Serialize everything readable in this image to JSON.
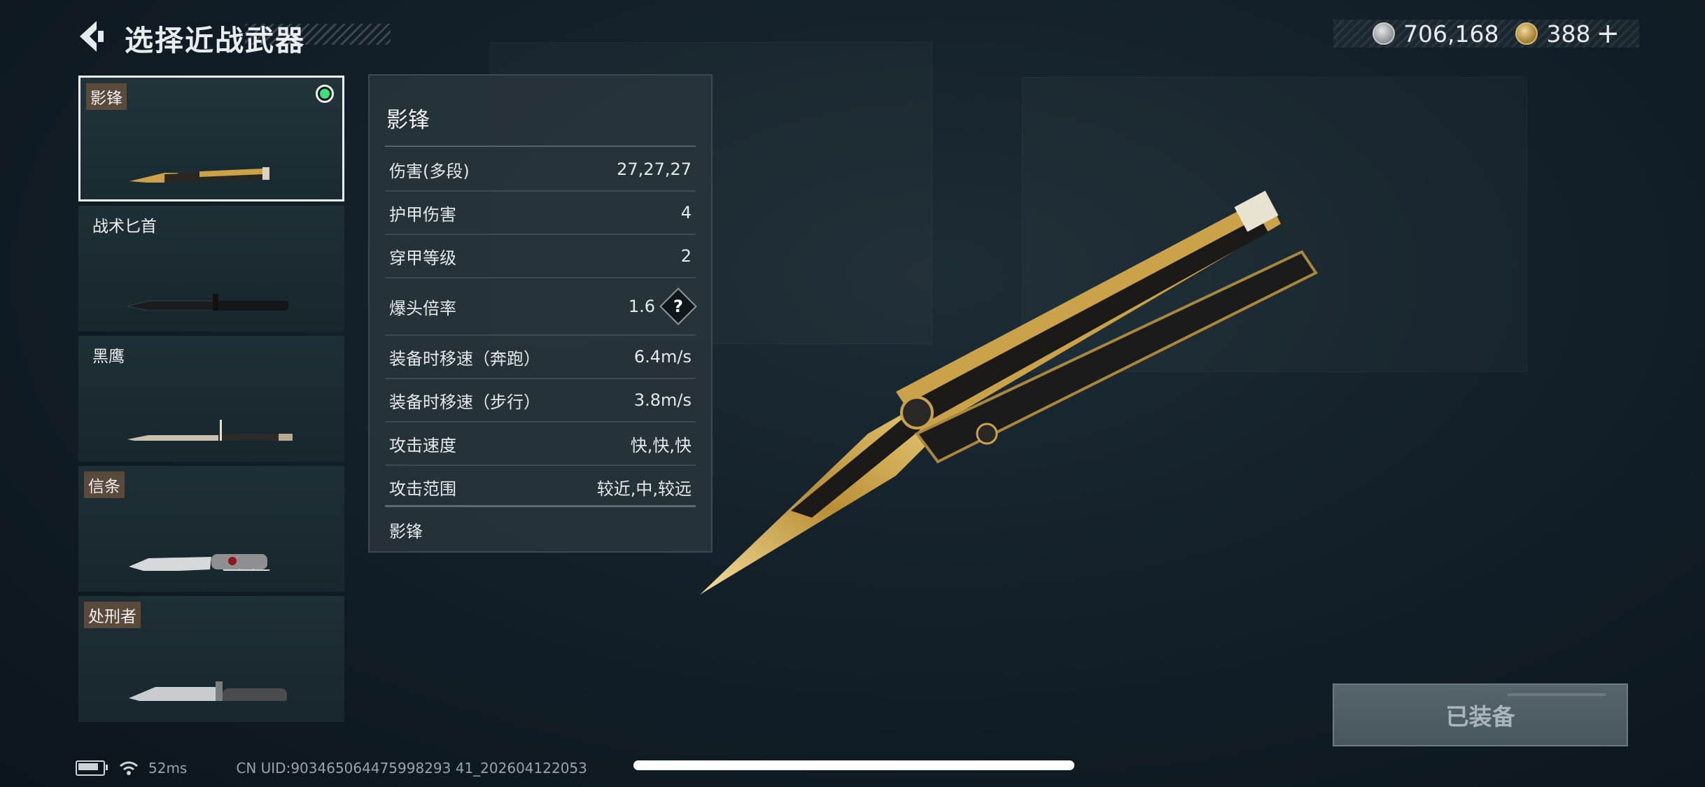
{
  "header": {
    "title": "选择近战武器",
    "back_icon": "chevron-left-icon"
  },
  "currency": {
    "silver_amount": "706,168",
    "gold_amount": "388",
    "add_label": "+"
  },
  "weapons": [
    {
      "name": "影锋",
      "tagged": true,
      "selected": true
    },
    {
      "name": "战术匕首",
      "tagged": false,
      "selected": false
    },
    {
      "name": "黑鹰",
      "tagged": false,
      "selected": false
    },
    {
      "name": "信条",
      "tagged": true,
      "selected": false
    },
    {
      "name": "处刑者",
      "tagged": true,
      "selected": false
    }
  ],
  "detail": {
    "name": "影锋",
    "stats": [
      {
        "label": "伤害(多段)",
        "value": "27,27,27"
      },
      {
        "label": "护甲伤害",
        "value": "4"
      },
      {
        "label": "穿甲等级",
        "value": "2"
      },
      {
        "label": "爆头倍率",
        "value": "1.6",
        "help": "?"
      },
      {
        "label": "装备时移速（奔跑）",
        "value": "6.4m/s"
      },
      {
        "label": "装备时移速（步行）",
        "value": "3.8m/s"
      },
      {
        "label": "攻击速度",
        "value": "快,快,快"
      },
      {
        "label": "攻击范围",
        "value": "较近,中,较远"
      }
    ],
    "footer": "影锋"
  },
  "equip_button": {
    "label": "已装备"
  },
  "status_bar": {
    "ping": "52ms",
    "uid": "CN UID:903465064475998293 41_202604122053"
  },
  "colors": {
    "selected_indicator": "#3be07d",
    "blade_gold": "#c9a24a"
  }
}
